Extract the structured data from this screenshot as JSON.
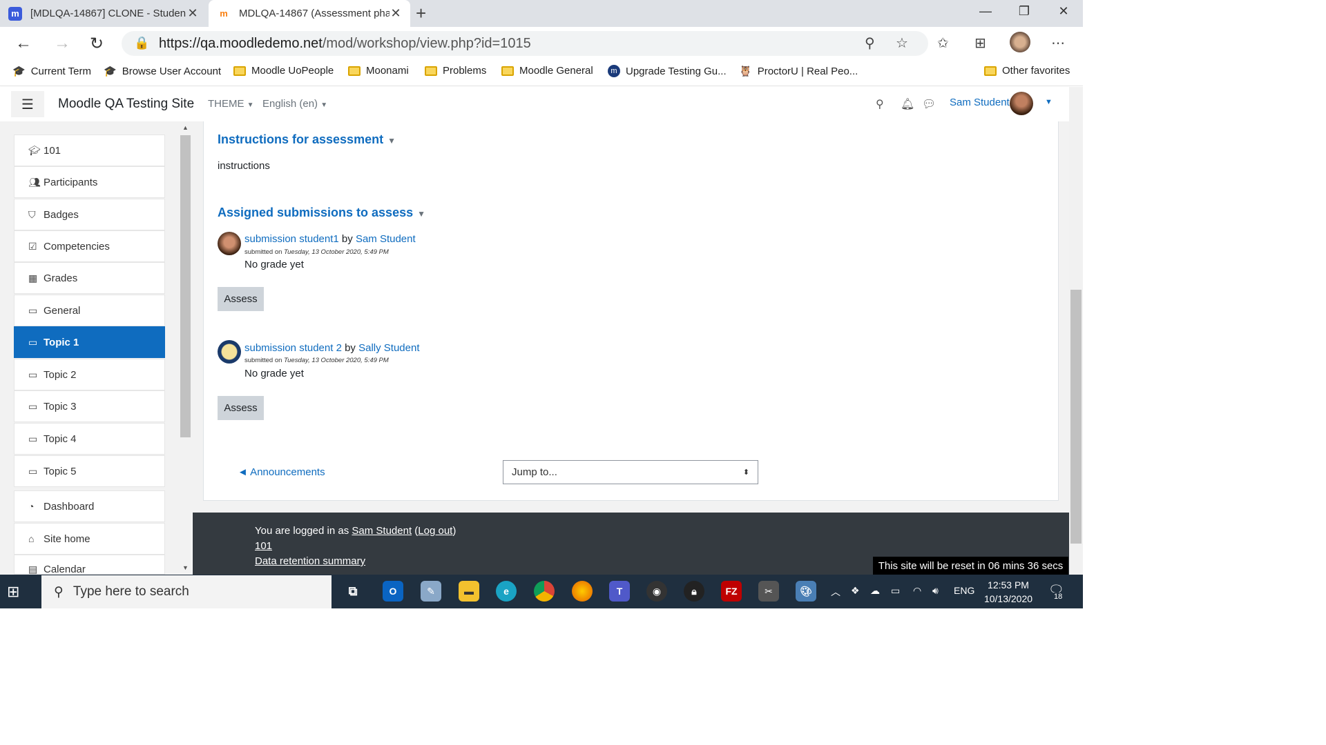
{
  "browser": {
    "tabs": [
      {
        "title": "[MDLQA-14867] CLONE - Studen",
        "icon": "moodle-tracker-icon",
        "active": false
      },
      {
        "title": "MDLQA-14867 (Assessment pha",
        "icon": "moodle-icon",
        "active": true
      }
    ],
    "url_host": "https://qa.moodledemo.net",
    "url_path": "/mod/workshop/view.php?id=1015",
    "bookmarks": [
      "Current Term",
      "Browse User Account",
      "Moodle UoPeople",
      "Moonami",
      "Problems",
      "Moodle General",
      "Upgrade Testing Gu...",
      "ProctorU | Real Peo..."
    ],
    "other_favorites": "Other favorites"
  },
  "navbar": {
    "site_name": "Moodle QA Testing Site",
    "theme": "THEME",
    "language": "English (en)",
    "user": "Sam Student"
  },
  "sidebar": {
    "items": [
      {
        "label": "101",
        "icon": "graduation-cap-icon"
      },
      {
        "label": "Participants",
        "icon": "users-icon"
      },
      {
        "label": "Badges",
        "icon": "shield-icon"
      },
      {
        "label": "Competencies",
        "icon": "check-square-icon"
      },
      {
        "label": "Grades",
        "icon": "table-icon"
      },
      {
        "label": "General",
        "icon": "folder-icon"
      },
      {
        "label": "Topic 1",
        "icon": "folder-icon",
        "active": true
      },
      {
        "label": "Topic 2",
        "icon": "folder-icon"
      },
      {
        "label": "Topic 3",
        "icon": "folder-icon"
      },
      {
        "label": "Topic 4",
        "icon": "folder-icon"
      },
      {
        "label": "Topic 5",
        "icon": "folder-icon"
      },
      {
        "label": "Dashboard",
        "icon": "dashboard-icon"
      },
      {
        "label": "Site home",
        "icon": "home-icon"
      },
      {
        "label": "Calendar",
        "icon": "calendar-icon"
      }
    ]
  },
  "main": {
    "instructions_heading": "Instructions for assessment",
    "instructions_text": "instructions",
    "assigned_heading": "Assigned submissions to assess",
    "submissions": [
      {
        "title": "submission student1",
        "by": "by",
        "author": "Sam Student",
        "submitted_label": "submitted on",
        "date": "Tuesday, 13 October 2020, 5:49 PM",
        "grade": "No grade yet",
        "button": "Assess"
      },
      {
        "title": "submission student 2",
        "by": "by",
        "author": "Sally Student",
        "submitted_label": "submitted on",
        "date": "Tuesday, 13 October 2020, 5:49 PM",
        "grade": "No grade yet",
        "button": "Assess"
      }
    ],
    "prev_link": "◄ Announcements",
    "jump_to": "Jump to..."
  },
  "footer": {
    "logged_in_prefix": "You are logged in as",
    "logged_in_user": "Sam Student",
    "logout": "Log out",
    "course_link": "101",
    "data_retention": "Data retention summary",
    "reset_notice": "This site will be reset in 06 mins 36 secs"
  },
  "taskbar": {
    "search_placeholder": "Type here to search",
    "language": "ENG",
    "time": "12:53 PM",
    "date": "10/13/2020",
    "notifications": "18"
  }
}
